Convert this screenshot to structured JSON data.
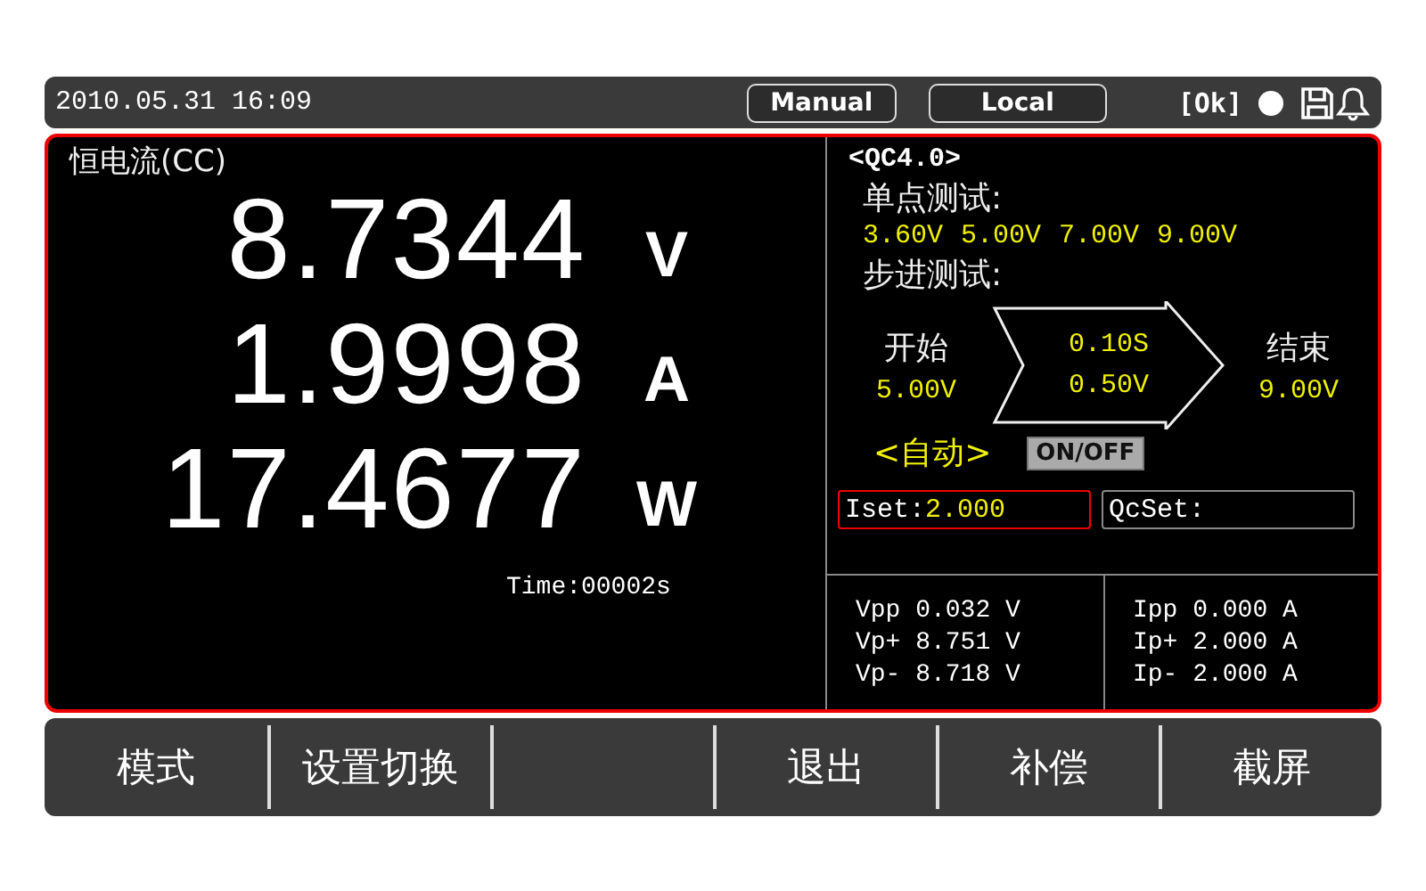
{
  "status_bar": {
    "datetime": "2010.05.31 16:09",
    "mode_buttons": [
      "Manual",
      "Local"
    ],
    "status": "[Ok]"
  },
  "main": {
    "mode": "恒电流(CC)",
    "readings": [
      {
        "value": "8.7344",
        "unit": "V"
      },
      {
        "value": "1.9998",
        "unit": "A"
      },
      {
        "value": "17.4677",
        "unit": "W"
      }
    ],
    "time": "Time:00002s"
  },
  "qc": {
    "title": "<QC4.0>",
    "single_label": "单点测试:",
    "single_values": [
      "3.60V",
      "5.00V",
      "7.00V",
      "9.00V"
    ],
    "step_label": "步进测试:",
    "start_label": "开始",
    "start_value": "5.00V",
    "step_time": "0.10S",
    "step_voltage": "0.50V",
    "end_label": "结束",
    "end_value": "9.00V",
    "auto_label": "<自动>",
    "toggle": "ON/OFF",
    "fields": [
      {
        "label": "Iset:",
        "value": "2.000",
        "selected": true
      },
      {
        "label": "QcSet:",
        "selected": false
      }
    ]
  },
  "peaks": {
    "voltage": [
      {
        "label": "Vpp",
        "value": "0.032 V"
      },
      {
        "label": "Vp+",
        "value": "8.751 V"
      },
      {
        "label": "Vp-",
        "value": "8.718 V"
      }
    ],
    "current": [
      {
        "label": "Ipp",
        "value": "0.000 A"
      },
      {
        "label": "Ip+",
        "value": "2.000 A"
      },
      {
        "label": "Ip-",
        "value": "2.000 A"
      }
    ]
  },
  "softkeys": [
    {
      "kind": "key",
      "label": "模式"
    },
    {
      "kind": "key",
      "label": "设置切换"
    },
    {
      "kind": "blank"
    },
    {
      "kind": "key",
      "label": "退出"
    },
    {
      "kind": "key",
      "label": "补偿"
    },
    {
      "kind": "key",
      "label": "截屏"
    }
  ]
}
